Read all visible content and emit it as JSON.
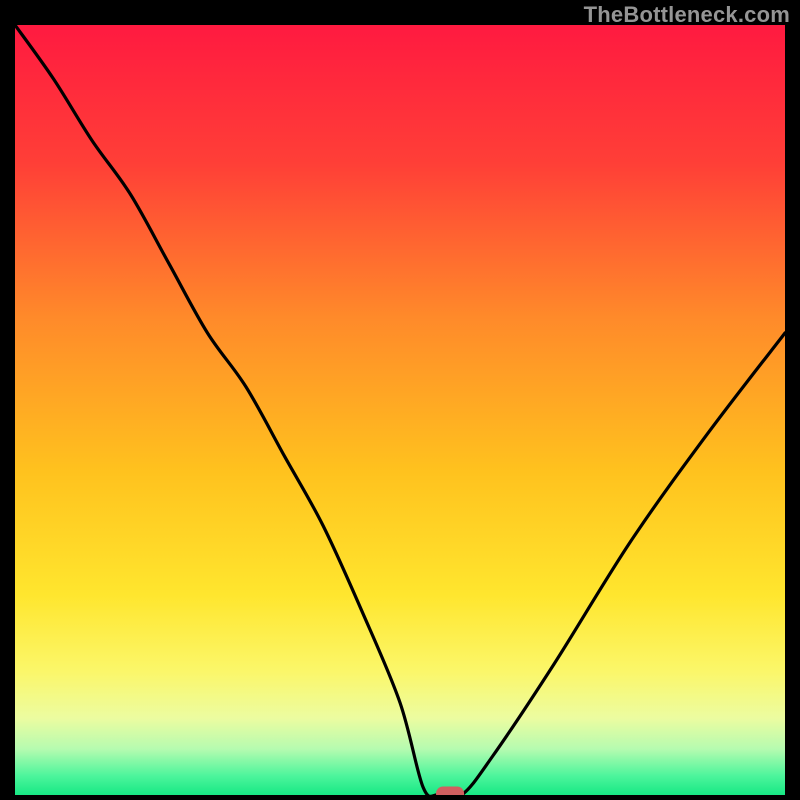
{
  "watermark": "TheBottleneck.com",
  "chart_data": {
    "type": "line",
    "title": "",
    "xlabel": "",
    "ylabel": "",
    "xlim": [
      0,
      100
    ],
    "ylim": [
      0,
      100
    ],
    "series": [
      {
        "name": "bottleneck-curve",
        "x": [
          0,
          5,
          10,
          15,
          20,
          25,
          30,
          35,
          40,
          45,
          50,
          53,
          55,
          58,
          62,
          70,
          80,
          90,
          100
        ],
        "y": [
          100,
          93,
          85,
          78,
          69,
          60,
          53,
          44,
          35,
          24,
          12,
          1,
          0,
          0,
          5,
          17,
          33,
          47,
          60
        ]
      }
    ],
    "marker": {
      "x": 56.5,
      "y": 0
    },
    "gradient_stops": [
      {
        "offset": 0.0,
        "color": "#ff1a40"
      },
      {
        "offset": 0.18,
        "color": "#ff3f37"
      },
      {
        "offset": 0.38,
        "color": "#ff8a2a"
      },
      {
        "offset": 0.58,
        "color": "#ffc21e"
      },
      {
        "offset": 0.74,
        "color": "#ffe62e"
      },
      {
        "offset": 0.84,
        "color": "#fbf76a"
      },
      {
        "offset": 0.9,
        "color": "#ecfca0"
      },
      {
        "offset": 0.94,
        "color": "#b6fbb0"
      },
      {
        "offset": 0.975,
        "color": "#4df59c"
      },
      {
        "offset": 1.0,
        "color": "#17e884"
      }
    ]
  }
}
